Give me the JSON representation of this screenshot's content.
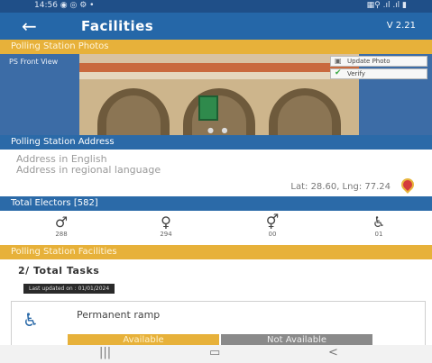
{
  "status_bar": {
    "time": "14:56 ◉ ◎ ⚙ •",
    "right": "▦⚲ .ıl .ıl ▮"
  },
  "app_bar": {
    "back_icon": "arrow-left-icon",
    "back_glyph": "←",
    "title": "Facilities",
    "version": "V 2.21"
  },
  "photos": {
    "header": "Polling Station Photos",
    "view_label": "PS Front View",
    "update_label": "Update Photo",
    "verify_label": "Verify",
    "page_dots": "● ●"
  },
  "address": {
    "header": "Polling Station Address",
    "english": "Address in English",
    "regional": "Address in regional language",
    "latlng": "Lat: 28.60, Lng: 77.24"
  },
  "electors": {
    "header": "Total Electors [582]",
    "items": [
      {
        "icon": "male-icon",
        "glyph": "♂",
        "count": "288"
      },
      {
        "icon": "female-icon",
        "glyph": "♀",
        "count": "294"
      },
      {
        "icon": "third-gender-icon",
        "glyph": "⚥",
        "count": "00"
      },
      {
        "icon": "pwd-icon",
        "glyph": "♿",
        "count": "01"
      }
    ]
  },
  "facilities": {
    "header": "Polling Station Facilities",
    "tasks_text": "2/ Total Tasks",
    "date_text": "Last updated on : 01/01/2024",
    "card": {
      "icon": "ramp-icon",
      "glyph": "♿",
      "label": "Permanent ramp",
      "available": "Available",
      "not_available": "Not Available"
    }
  },
  "nav": {
    "recent": "|||",
    "home": "▭",
    "back": "<"
  },
  "colors": {
    "accent_blue": "#2567a8",
    "accent_yellow": "#e7b13a",
    "grey_button": "#8a8a8a"
  }
}
